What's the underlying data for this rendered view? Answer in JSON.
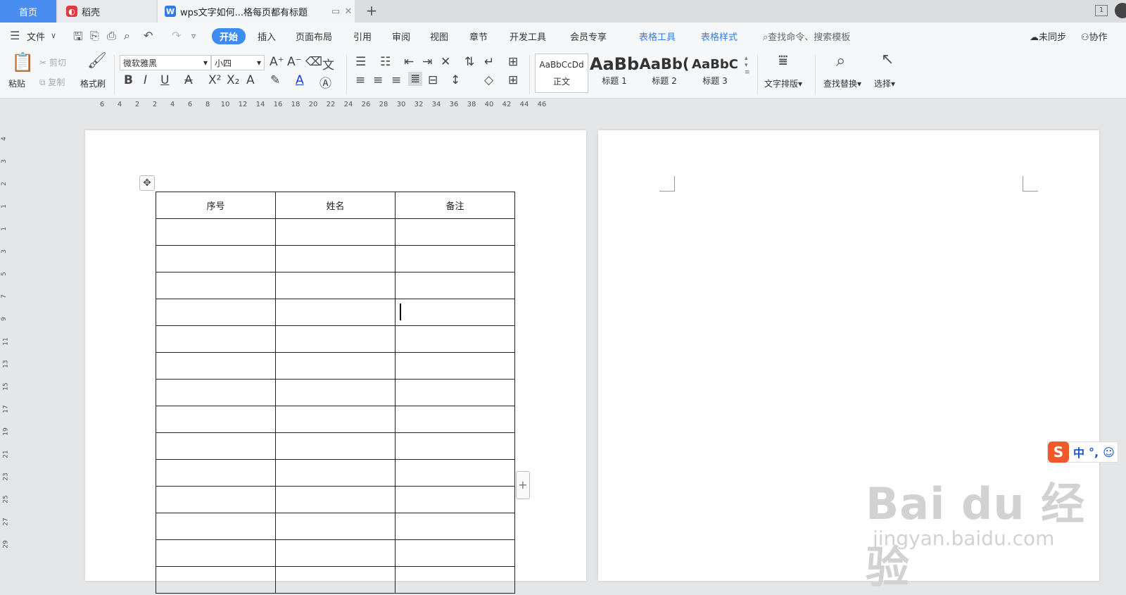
{
  "tabs": {
    "home": "首页",
    "daoke": "稻壳",
    "doc": "wps文字如何...格每页都有标题",
    "window_num": "1"
  },
  "menu": {
    "file": "文件",
    "start": "开始",
    "insert": "插入",
    "layout": "页面布局",
    "reference": "引用",
    "review": "审阅",
    "view": "视图",
    "chapter": "章节",
    "dev": "开发工具",
    "member": "会员专享",
    "table_tools": "表格工具",
    "table_style": "表格样式",
    "search": "查找命令、搜索模板",
    "sync": "未同步",
    "collab": "协作"
  },
  "ribbon": {
    "paste": "粘贴",
    "cut": "剪切",
    "copy": "复制",
    "format_painter": "格式刷",
    "font": "微软雅黑",
    "size": "小四",
    "styles": [
      {
        "preview": "AaBbCcDd",
        "label": "正文"
      },
      {
        "preview": "AaBb",
        "label": "标题 1"
      },
      {
        "preview": "AaBb(",
        "label": "标题 2"
      },
      {
        "preview": "AaBbC",
        "label": "标题 3"
      }
    ],
    "text_layout": "文字排版",
    "find_replace": "查找替换",
    "select": "选择"
  },
  "ruler": {
    "h_ticks": [
      "6",
      "4",
      "2",
      "2",
      "4",
      "6",
      "8",
      "10",
      "12",
      "14",
      "16",
      "18",
      "20",
      "22",
      "24",
      "26",
      "28",
      "30",
      "32",
      "34",
      "36",
      "38",
      "40",
      "42",
      "44",
      "46"
    ],
    "v_ticks": [
      "4",
      "3",
      "2",
      "1",
      "1",
      "3",
      "5",
      "7",
      "9",
      "11",
      "13",
      "15",
      "17",
      "19",
      "21",
      "23",
      "25",
      "27",
      "29"
    ]
  },
  "table": {
    "headers": [
      "序号",
      "姓名",
      "备注"
    ],
    "rows": 14
  },
  "ime": {
    "mode": "中",
    "punct": "°,",
    "emoji": "☺"
  },
  "watermark": {
    "line1": "Bai du 经验",
    "line2": "jingyan.baidu.com"
  }
}
